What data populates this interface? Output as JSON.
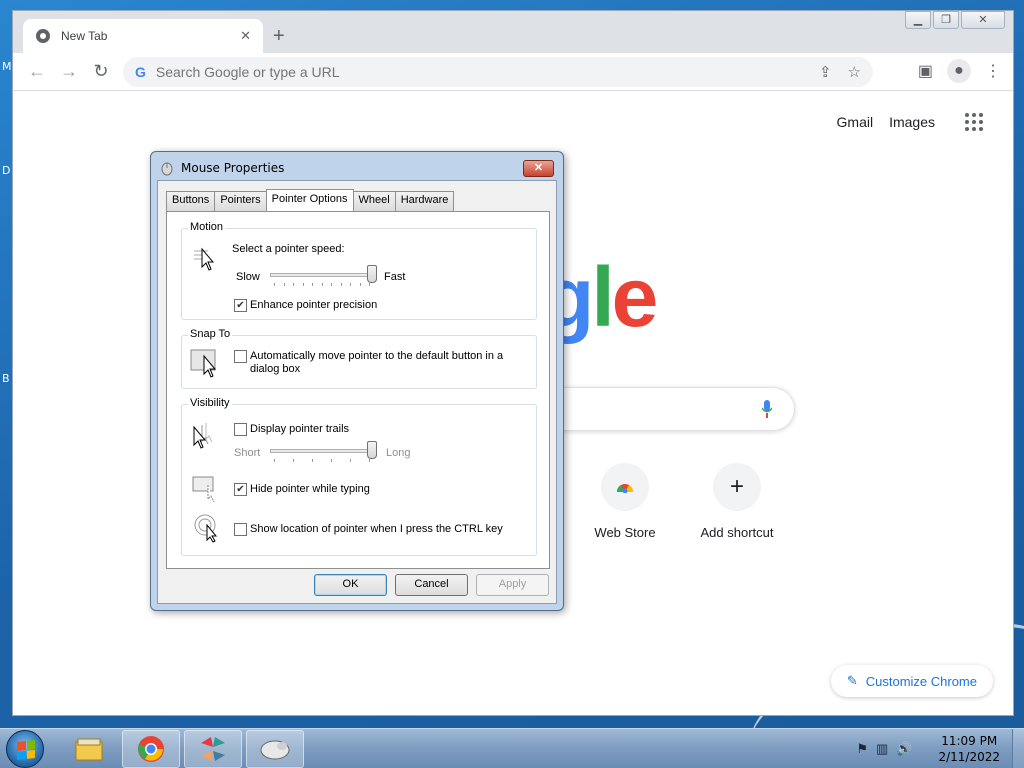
{
  "desktop": {
    "edge_letters": [
      "M",
      "D",
      "B"
    ]
  },
  "browser": {
    "tab_title": "New Tab",
    "omnibox_placeholder": "Search Google or type a URL",
    "top_links": [
      "Gmail",
      "Images"
    ],
    "logo_visible_text": "gle",
    "shortcuts": [
      {
        "label": "Web Store",
        "icon": "chrome-web-store-icon"
      },
      {
        "label": "Add shortcut",
        "icon": "plus-icon"
      }
    ],
    "customize_label": "Customize Chrome"
  },
  "dialog": {
    "title": "Mouse Properties",
    "tabs": [
      "Buttons",
      "Pointers",
      "Pointer Options",
      "Wheel",
      "Hardware"
    ],
    "active_tab": "Pointer Options",
    "motion": {
      "legend": "Motion",
      "prompt": "Select a pointer speed:",
      "slow": "Slow",
      "fast": "Fast",
      "speed_fraction": 0.98,
      "enhance_label": "Enhance pointer precision",
      "enhance_checked": true
    },
    "snap": {
      "legend": "Snap To",
      "label_line1": "Automatically move pointer to the default button in a",
      "label_line2": "dialog box",
      "checked": false
    },
    "visibility": {
      "legend": "Visibility",
      "trails_label": "Display pointer trails",
      "trails_checked": false,
      "short": "Short",
      "long": "Long",
      "trail_fraction": 0.98,
      "hide_label": "Hide pointer while typing",
      "hide_checked": true,
      "ctrl_label": "Show location of pointer when I press the CTRL key",
      "ctrl_checked": false
    },
    "buttons": {
      "ok": "OK",
      "cancel": "Cancel",
      "apply": "Apply"
    }
  },
  "taskbar": {
    "apps": [
      "windows-explorer-icon",
      "chrome-icon",
      "app-icon",
      "mouse-icon"
    ],
    "time": "11:09 PM",
    "date": "2/11/2022"
  }
}
